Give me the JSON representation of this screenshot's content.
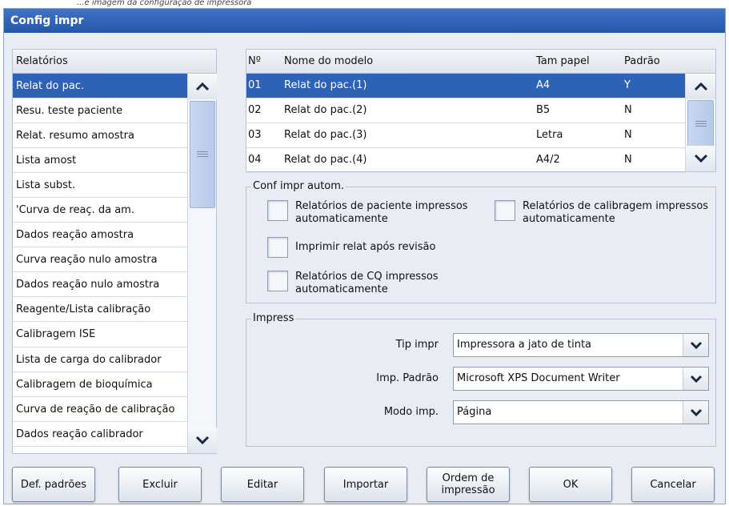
{
  "top_caption": "...e imagem da configuração de impressora",
  "window": {
    "title": "Config impr"
  },
  "reports": {
    "header": "Relatórios",
    "items": [
      "Relat do pac.",
      "Resu. teste paciente",
      "Relat. resumo amostra",
      "Lista amost",
      "Lista subst.",
      "'Curva de reaç. da am.",
      "Dados reação amostra",
      "Curva reação nulo amostra",
      "Dados reação nulo amostra",
      "Reagente/Lista calibração",
      "Calibragem ISE",
      "Lista de carga do calibrador",
      "Calibragem de bioquímica",
      "Curva de reação de calibração",
      "Dados reação calibrador"
    ],
    "selected_index": 0
  },
  "models": {
    "headers": {
      "no": "Nº",
      "name": "Nome do modelo",
      "size": "Tam papel",
      "default": "Padrão"
    },
    "rows": [
      {
        "no": "01",
        "name": "Relat do pac.(1)",
        "size": "A4",
        "default": "Y"
      },
      {
        "no": "02",
        "name": "Relat do pac.(2)",
        "size": "B5",
        "default": "N"
      },
      {
        "no": "03",
        "name": "Relat do pac.(3)",
        "size": "Letra",
        "default": "N"
      },
      {
        "no": "04",
        "name": "Relat do pac.(4)",
        "size": "A4/2",
        "default": "N"
      }
    ],
    "selected_index": 0
  },
  "auto_print": {
    "title": "Conf impr autom.",
    "patient": "Relatórios de paciente impressos\nautomaticamente",
    "calibration": "Relatórios de calibragem impressos\nautomaticamente",
    "after_review": "Imprimir relat após revisão",
    "qc": "Relatórios de CQ impressos\nautomaticamente"
  },
  "printer": {
    "title": "Impress",
    "type_label": "Tip impr",
    "type_value": "Impressora a jato de tinta",
    "default_label": "Imp. Padrão",
    "default_value": "Microsoft XPS Document Writer",
    "mode_label": "Modo imp.",
    "mode_value": "Página"
  },
  "buttons": {
    "defaults": "Def. padrões",
    "delete": "Excluir",
    "edit": "Editar",
    "import": "Importar",
    "print_order": "Ordem de\nimpressão",
    "ok": "OK",
    "cancel": "Cancelar"
  },
  "colors": {
    "title_bar": "#2d62b7",
    "selection": "#2d62b7",
    "background": "#e9edf3"
  },
  "icons": {
    "scroll_up": "chevron-up-icon",
    "scroll_down": "chevron-down-icon",
    "dropdown": "chevron-down-icon",
    "thumb_grip": "grip-lines-icon"
  }
}
